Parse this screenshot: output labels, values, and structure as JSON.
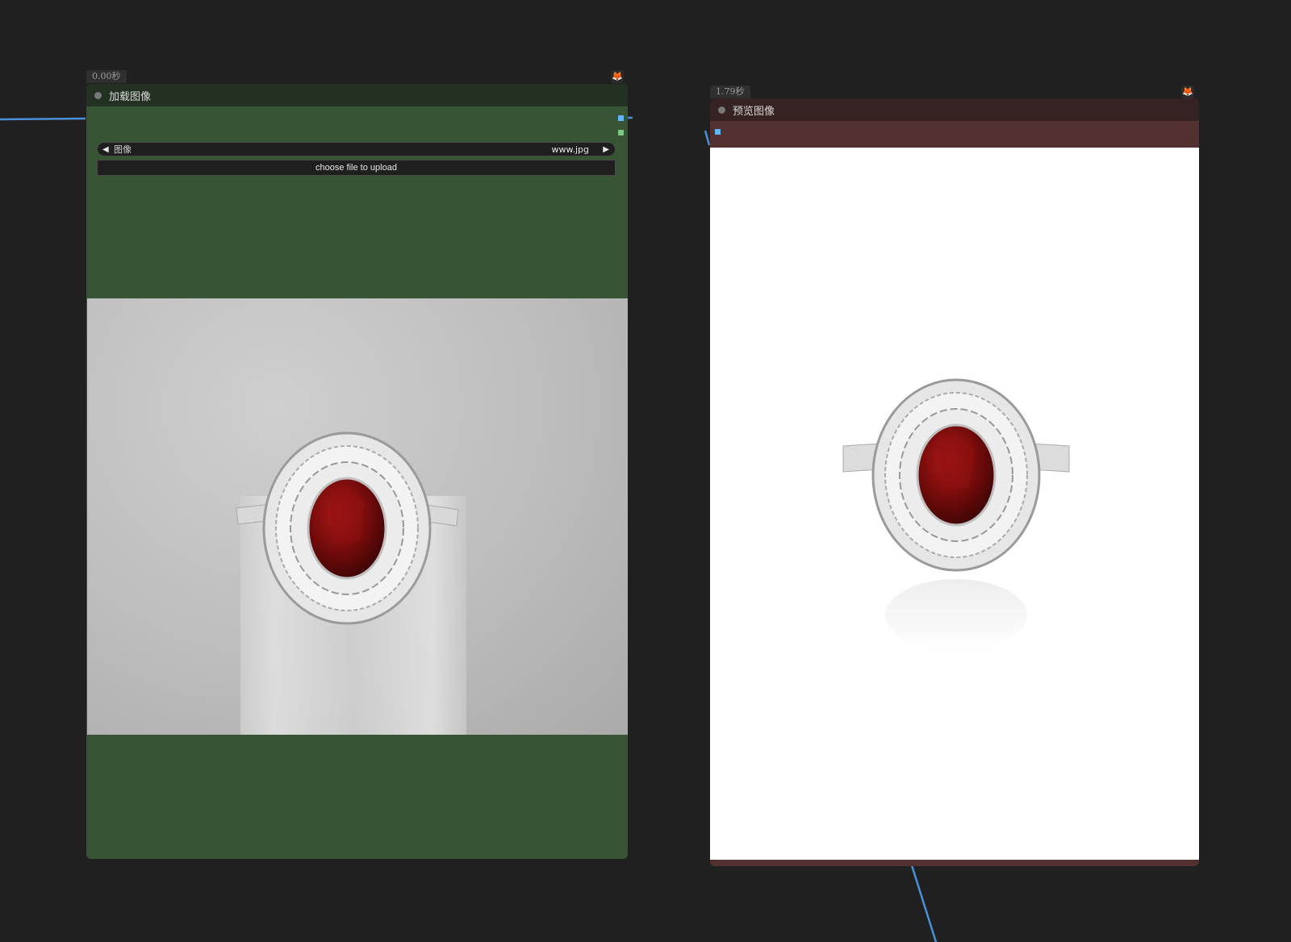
{
  "load_node": {
    "time_badge": "0.00秒",
    "title": "加载图像",
    "image_combo": {
      "label": "图像",
      "value": "www.jpg"
    },
    "upload_button": "choose file to upload"
  },
  "preview_node": {
    "time_badge": "1.79秒",
    "title": "预览图像"
  },
  "colors": {
    "canvas": "#202020",
    "load_body": "#375535",
    "load_header": "#233123",
    "preview_body": "#533131",
    "preview_header": "#362222",
    "link_image": "#4a90d9",
    "port_image": "#64b5f6",
    "port_mask": "#81c784"
  },
  "icons": [
    "fox-icon",
    "dropdown-left-arrow-icon",
    "dropdown-right-arrow-icon",
    "status-dot-icon"
  ]
}
